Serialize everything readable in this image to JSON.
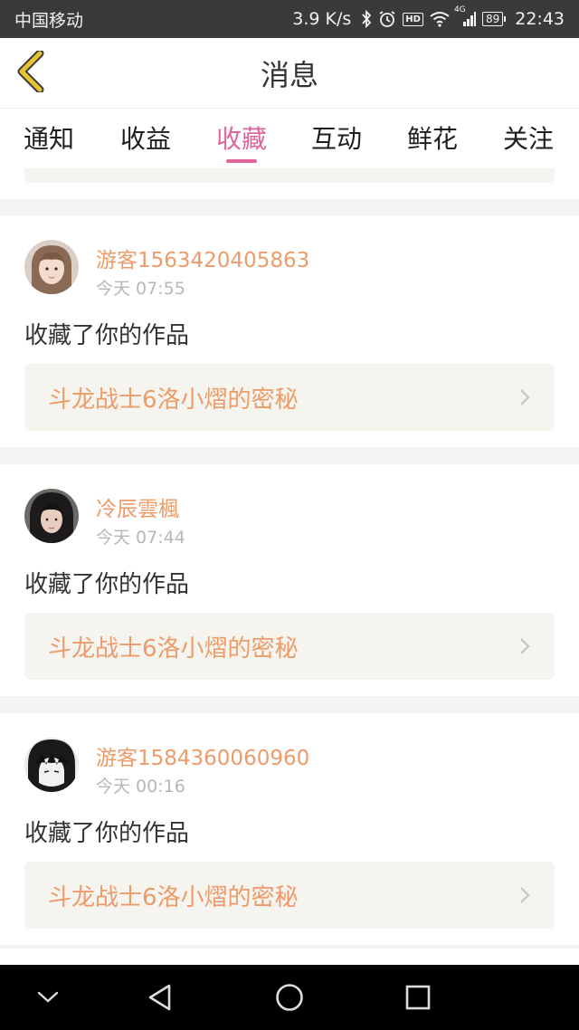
{
  "status_bar": {
    "carrier": "中国移动",
    "net_speed": "3.9 K/s",
    "hd_label": "HD",
    "network_label": "4G",
    "battery": "89",
    "time": "22:43",
    "icons": [
      "bluetooth-icon",
      "alarm-icon",
      "hd-icon",
      "wifi-icon",
      "signal-icon",
      "battery-icon"
    ]
  },
  "header": {
    "title": "消息",
    "back_icon": "chevron-left-icon",
    "accent_color": "#e8c233"
  },
  "tabs": {
    "items": [
      {
        "label": "通知"
      },
      {
        "label": "收益"
      },
      {
        "label": "收藏"
      },
      {
        "label": "互动"
      },
      {
        "label": "鲜花"
      },
      {
        "label": "关注"
      }
    ],
    "active": "收藏",
    "active_color": "#e0669a"
  },
  "messages": [
    {
      "username": "游客1563420405863",
      "time": "今天 07:55",
      "action": "收藏了你的作品",
      "work_title": "斗龙战士6洛小熠的密秘",
      "avatar": "avatar-girl"
    },
    {
      "username": "冷辰雲楓",
      "time": "今天 07:44",
      "action": "收藏了你的作品",
      "work_title": "斗龙战士6洛小熠的密秘",
      "avatar": "avatar-boy-dark-hair"
    },
    {
      "username": "游客1584360060960",
      "time": "今天 00:16",
      "action": "收藏了你的作品",
      "work_title": "斗龙战士6洛小熠的密秘",
      "avatar": "avatar-anime-boy"
    }
  ],
  "colors": {
    "username": "#ec9b69",
    "link_bg": "#f6f4ee"
  },
  "nav_bar": {
    "icons": [
      "collapse-icon",
      "back-triangle-icon",
      "home-circle-icon",
      "recents-square-icon"
    ]
  }
}
